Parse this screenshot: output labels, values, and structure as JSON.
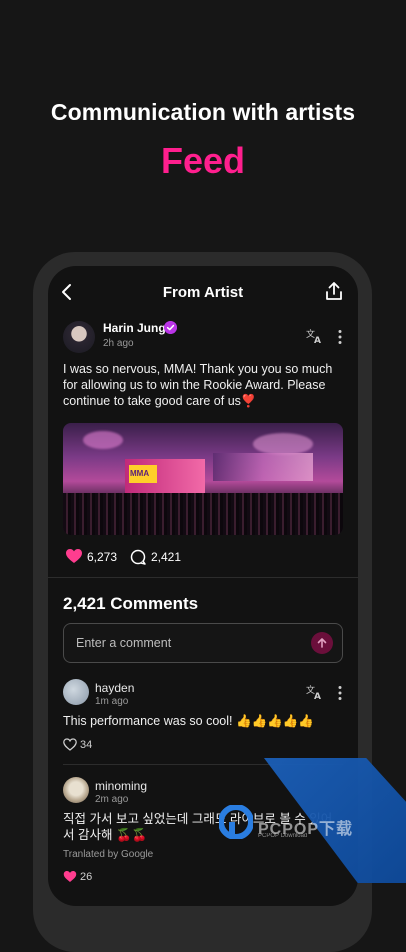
{
  "promo": {
    "headline": "Communication with artists",
    "title": "Feed"
  },
  "nav": {
    "title": "From Artist"
  },
  "post": {
    "author": "Harin Jung",
    "time": "2h ago",
    "text": "I was so nervous, MMA! Thank you you so much for allowing us to win the Rookie Award. Please continue to take good care of us❣️",
    "image_text": "MMA",
    "likes": "6,273",
    "comments": "2,421"
  },
  "comments_section": {
    "title": "2,421 Comments",
    "input_placeholder": "Enter a comment",
    "items": [
      {
        "user": "hayden",
        "time": "1m ago",
        "text": "This performance was so cool! 👍👍👍👍👍",
        "likes": "34"
      },
      {
        "user": "minoming",
        "time": "2m ago",
        "text": "직접 가서 보고 싶었는데 그래도 라이브로 볼 수 있어서 감사해 🍒🍒",
        "translated": "Tranlated by Google",
        "likes": "26"
      }
    ]
  },
  "watermark": {
    "text": "PCPOP下载",
    "sub": "PCPOP Download"
  },
  "colors": {
    "accent": "#ff1f8e",
    "verified": "#b934e6",
    "background": "#161616"
  }
}
